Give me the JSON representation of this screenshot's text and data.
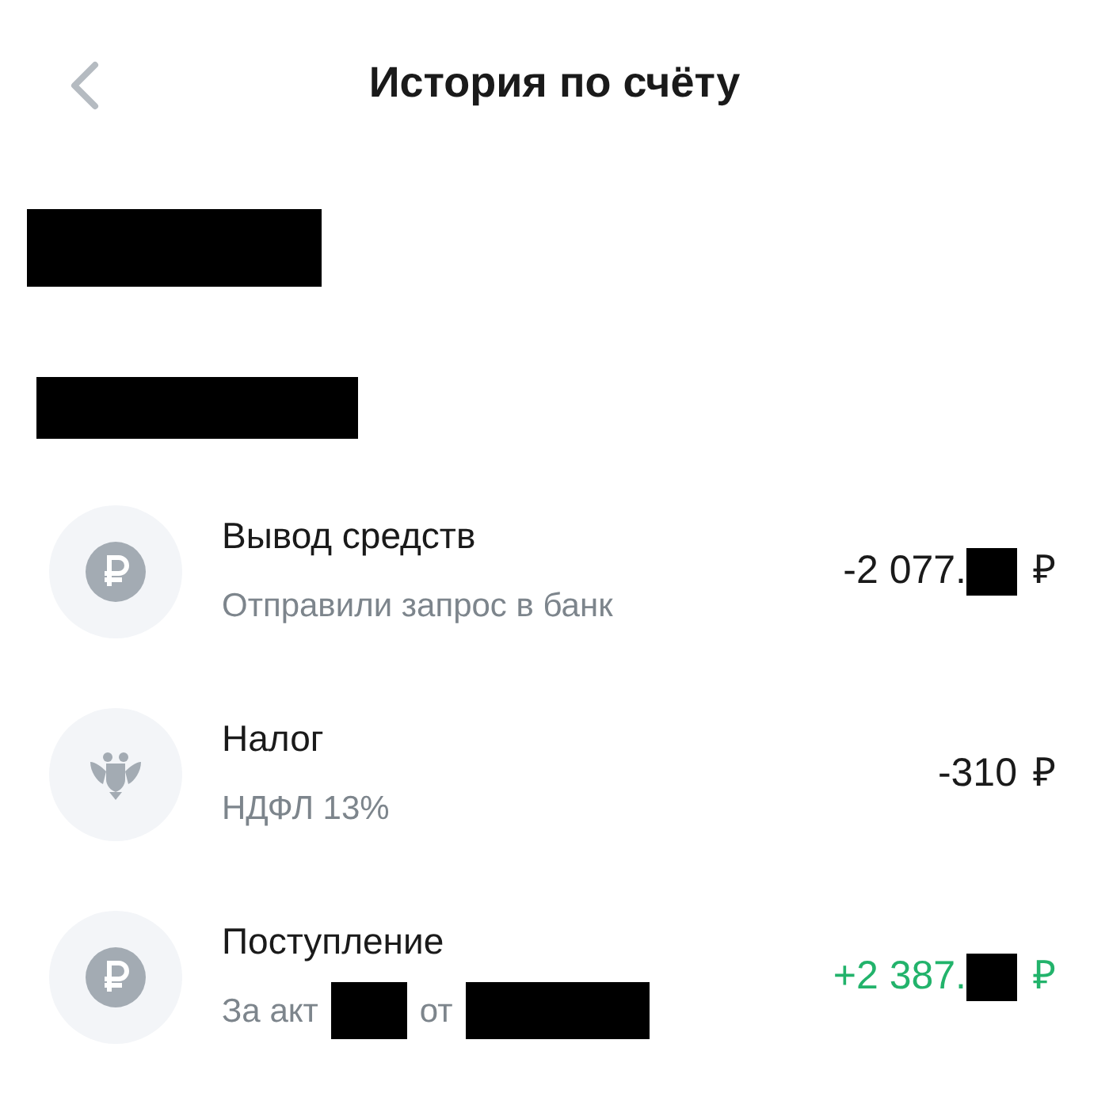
{
  "header": {
    "title": "История по счёту"
  },
  "redacted_lines": [
    {
      "kind": "redacted"
    },
    {
      "kind": "redacted"
    }
  ],
  "transactions": [
    {
      "kind": "ruble",
      "title": "Вывод средств",
      "subtitle": [
        {
          "kind": "text",
          "text": "Отправили запрос в банк"
        }
      ],
      "amount": "-2 077.",
      "amount_redacted": true,
      "currency": "₽",
      "positive": false
    },
    {
      "kind": "emblem",
      "title": "Налог",
      "subtitle": [
        {
          "kind": "text",
          "text": "НДФЛ 13%"
        }
      ],
      "amount": "-310",
      "amount_redacted": false,
      "currency": "₽",
      "positive": false
    },
    {
      "kind": "ruble",
      "title": "Поступление",
      "subtitle": [
        {
          "kind": "text",
          "text": "За акт"
        },
        {
          "kind": "redacted"
        },
        {
          "kind": "text",
          "text": "от"
        },
        {
          "kind": "redacted"
        }
      ],
      "amount": "+2 387.",
      "amount_redacted": true,
      "currency": "₽",
      "positive": true
    }
  ]
}
